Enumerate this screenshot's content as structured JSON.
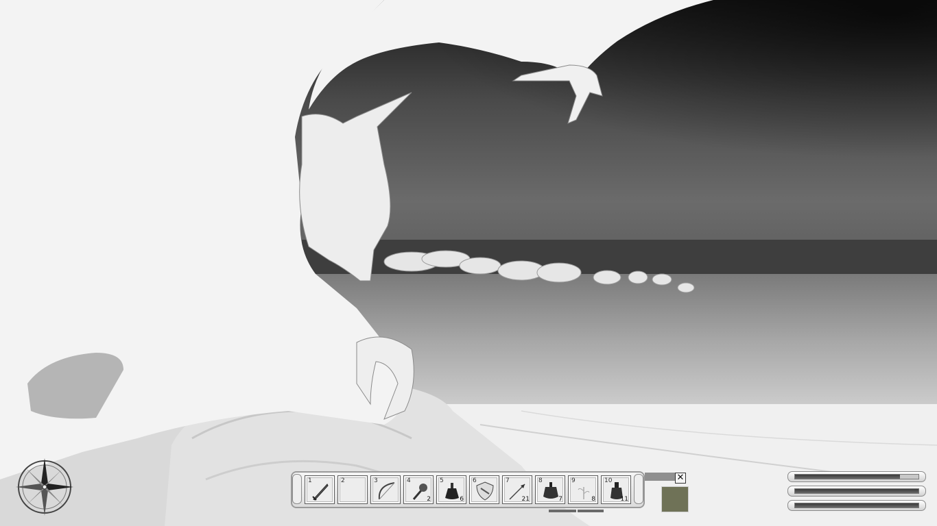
{
  "hotbar": {
    "slots": [
      {
        "number": "1",
        "item": "sword-icon",
        "quantity": ""
      },
      {
        "number": "2",
        "item": "",
        "quantity": ""
      },
      {
        "number": "3",
        "item": "bow-icon",
        "quantity": ""
      },
      {
        "number": "4",
        "item": "torch-icon",
        "quantity": "2"
      },
      {
        "number": "5",
        "item": "potion-icon",
        "quantity": "6"
      },
      {
        "number": "6",
        "item": "shield-icon",
        "quantity": ""
      },
      {
        "number": "7",
        "item": "arrow-icon",
        "quantity": "21"
      },
      {
        "number": "8",
        "item": "potion-icon",
        "quantity": "7"
      },
      {
        "number": "9",
        "item": "herb-icon",
        "quantity": "8"
      },
      {
        "number": "10",
        "item": "flask-icon",
        "quantity": "11"
      }
    ]
  },
  "close_label": "✕",
  "status": {
    "health": 0.85,
    "magicka": 1.0,
    "fatigue": 1.0
  },
  "colors": {
    "portrait": "#6f7257",
    "sky_dark": "#1a1a1a",
    "ground_light": "#f2f2f2"
  }
}
